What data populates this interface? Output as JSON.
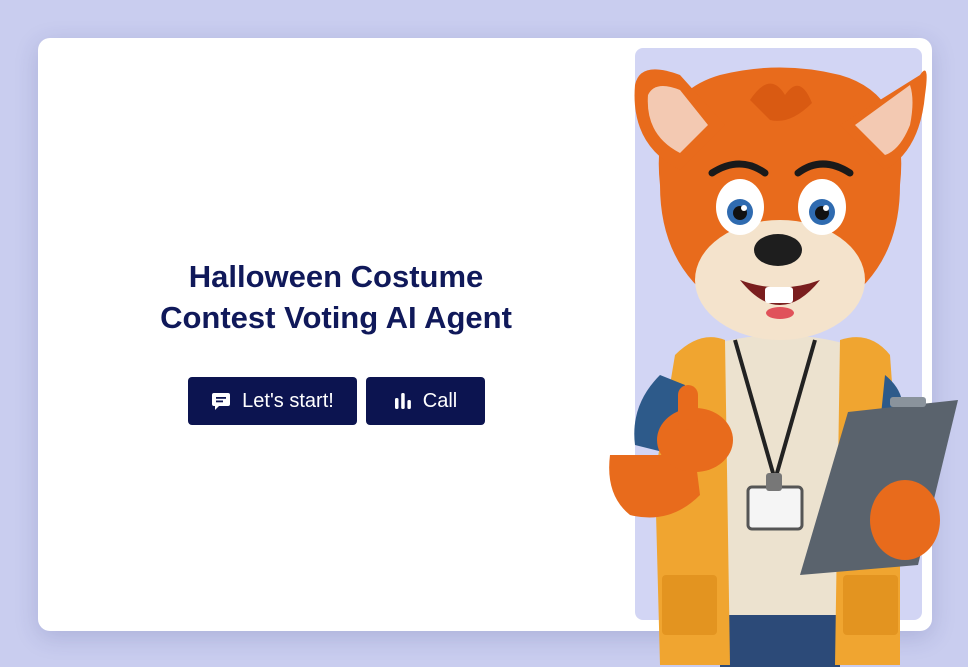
{
  "hero": {
    "title_line1": "Halloween Costume",
    "title_line2": "Contest Voting AI Agent"
  },
  "actions": {
    "start_label": "Let's start!",
    "start_icon": "chat-icon",
    "call_label": "Call",
    "call_icon": "audio-bars-icon"
  },
  "mascot": {
    "name": "fox-mascot-illustration"
  },
  "colors": {
    "background": "#c9cdef",
    "card": "#ffffff",
    "title": "#10195a",
    "button": "#0c1450",
    "mascot_panel": "#d2d5f4"
  }
}
